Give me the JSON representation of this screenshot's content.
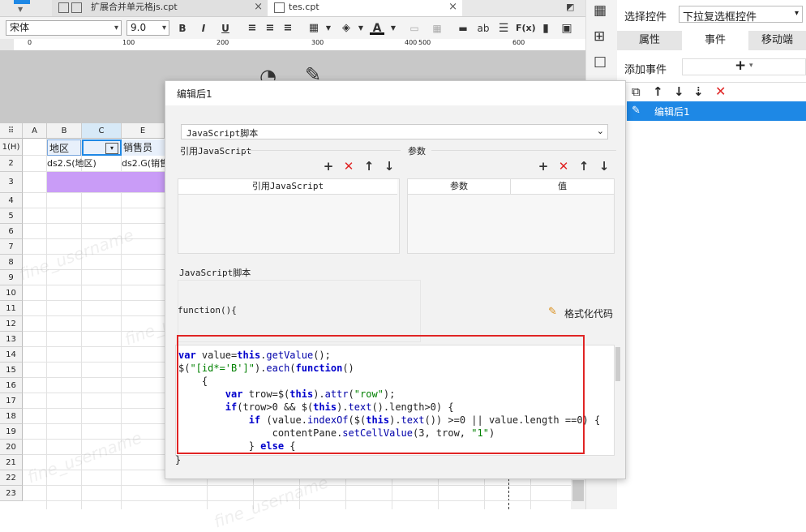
{
  "tabs": [
    {
      "label": "扩展合并单元格js.cpt"
    },
    {
      "label": "tes.cpt"
    }
  ],
  "toolbar": {
    "font": "宋体",
    "size": "9.0",
    "bold": "B",
    "italic": "I",
    "underline": "U",
    "text_icon": "ab",
    "formula_icon": "F(x)"
  },
  "ruler": {
    "ticks": [
      "0",
      "100",
      "200",
      "300",
      "400",
      "500",
      "600"
    ]
  },
  "grid": {
    "corner": "⠿",
    "columns": [
      "A",
      "B",
      "C",
      "E"
    ],
    "rows": [
      "1(H)",
      "2",
      "3",
      "4",
      "5",
      "6",
      "7",
      "8",
      "9",
      "10",
      "11",
      "12",
      "13",
      "14",
      "15",
      "16",
      "17",
      "18",
      "19",
      "20",
      "21",
      "22",
      "23"
    ],
    "cells": {
      "b1": "地区",
      "e1": "销售员",
      "b2": "ds2.S(地区)",
      "e2": "ds2.G(销售"
    },
    "watermark": "fine_username"
  },
  "dialog": {
    "title": "编辑后1",
    "type_select": "JavaScript脚本",
    "ref_section": "引用JavaScript",
    "ref_header": "引用JavaScript",
    "param_section": "参数",
    "param_headers": [
      "参数",
      "值"
    ],
    "script_section": "JavaScript脚本",
    "function_open": "function(){",
    "format_label": "格式化代码",
    "function_close": "}"
  },
  "code_lines": [
    "var value=this.getValue();",
    "$(\"[id*='B']\").each(function()",
    "    {",
    "        var trow=$(this).attr(\"row\");",
    "        if(trow>0 && $(this).text().length>0) {",
    "            if (value.indexOf($(this).text()) >=0 || value.length ==0) {",
    "                contentPane.setCellValue(3, trow, \"1\")",
    "            } else {"
  ],
  "right_panel": {
    "select_label": "选择控件",
    "select_value": "下拉复选框控件",
    "tabs": [
      "属性",
      "事件",
      "移动端"
    ],
    "add_event_label": "添加事件",
    "event_item": "编辑后1"
  },
  "colors": {
    "accent": "#1e88e5",
    "highlight_row": "#c99cf7",
    "red": "#e02424"
  }
}
